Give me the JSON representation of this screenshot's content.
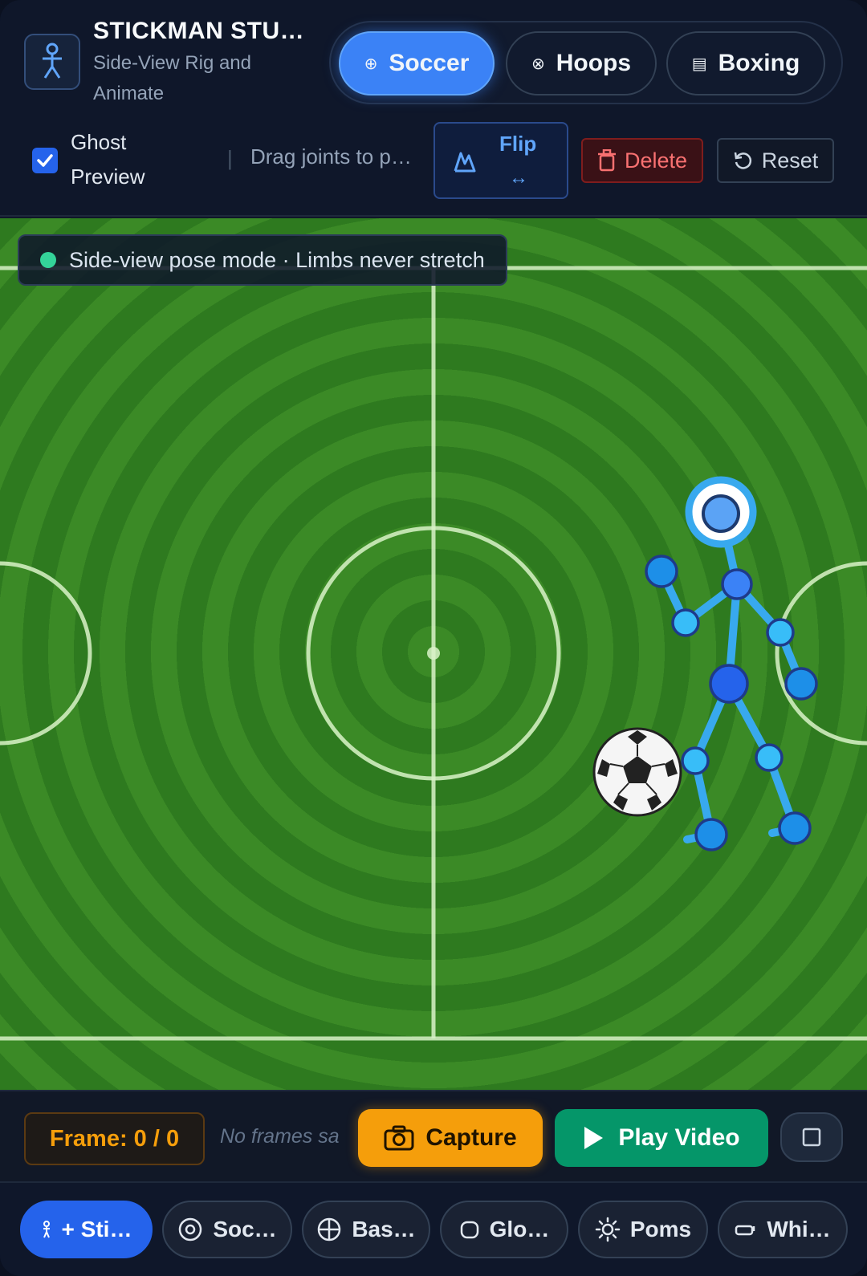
{
  "header": {
    "title": "STICKMAN STU…",
    "subtitle": "Side-View Rig and Animate",
    "modes": [
      {
        "label": "Soccer",
        "icon": "soccer-icon",
        "active": true
      },
      {
        "label": "Hoops",
        "icon": "basketball-icon",
        "active": false
      },
      {
        "label": "Boxing",
        "icon": "boxing-icon",
        "active": false
      }
    ],
    "ghost_preview_label": "Ghost Preview",
    "ghost_preview_checked": true,
    "separator": "|",
    "hint": "Drag joints to p…",
    "flip_label": "Flip",
    "flip_arrow": "↔",
    "delete_label": "Delete",
    "reset_label": "Reset"
  },
  "field": {
    "status_text": "Side-view pose mode · Limbs never stretch",
    "status_color": "#34d399",
    "ball_icon": "soccer-ball"
  },
  "timeline": {
    "frame_label": "Frame: 0 / 0",
    "no_frames_text": "No frames sa",
    "capture_label": "Capture",
    "play_label": "Play Video"
  },
  "toolbar": {
    "items": [
      {
        "label": "+ Sti…",
        "icon": "stickman-icon"
      },
      {
        "label": "Soc…",
        "icon": "target-icon"
      },
      {
        "label": "Bas…",
        "icon": "basketball-icon"
      },
      {
        "label": "Glo…",
        "icon": "glove-icon"
      },
      {
        "label": "Poms",
        "icon": "sun-icon"
      },
      {
        "label": "Whi…",
        "icon": "whistle-icon"
      }
    ]
  },
  "colors": {
    "accent": "#3b82f6",
    "capture": "#f59e0b",
    "play": "#059669",
    "delete": "#f87171",
    "grass_light": "#3b8a26",
    "grass_dark": "#2e7a1f",
    "rig": "#38a9ee"
  }
}
